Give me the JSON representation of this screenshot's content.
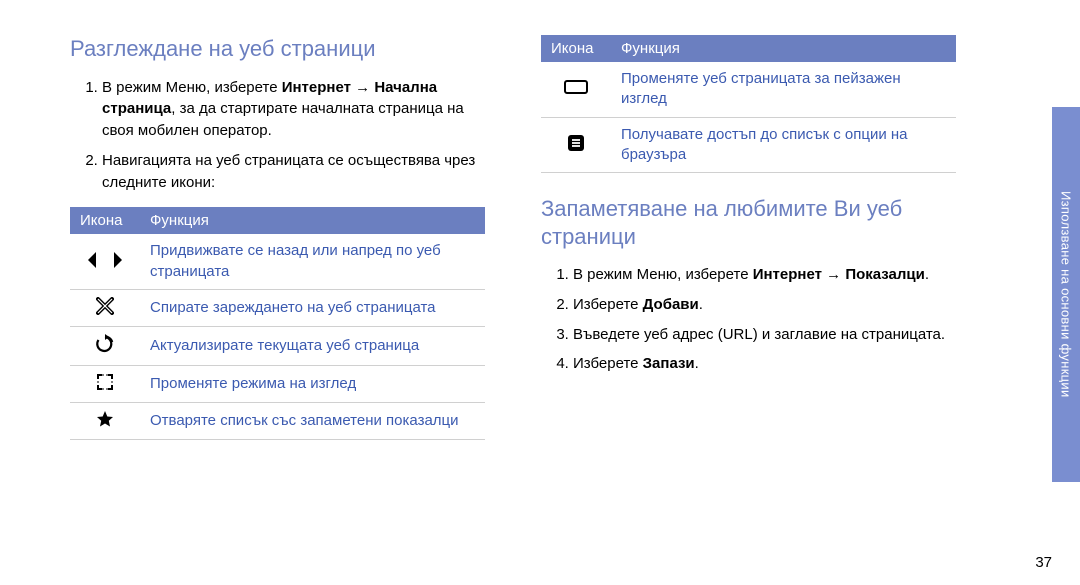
{
  "left": {
    "heading": "Разглеждане на уеб страници",
    "step1_pre": "В режим Меню, изберете ",
    "step1_b1": "Интернет",
    "step1_arrow": " → ",
    "step1_b2": "Начална страница",
    "step1_post": ", за да стартирате началната страница на своя мобилен оператор.",
    "step2": "Навигацията на уеб страницата се осъществява чрез следните икони:",
    "th_icon": "Икона",
    "th_func": "Функция",
    "rows": [
      {
        "fn": "Придвижвате се назад или напред по уеб страницата"
      },
      {
        "fn": "Спирате зареждането на уеб страницата"
      },
      {
        "fn": "Актуализирате текущата уеб страница"
      },
      {
        "fn": "Променяте режима на изглед"
      },
      {
        "fn": "Отваряте списък със запаметени показалци"
      }
    ]
  },
  "right": {
    "th_icon": "Икона",
    "th_func": "Функция",
    "rows": [
      {
        "fn": "Променяте уеб страницата за пейзажен изглед"
      },
      {
        "fn": "Получавате достъп до списък с опции на браузъра"
      }
    ],
    "heading": "Запаметяване на любимите Ви уеб страници",
    "s1_pre": "В режим Меню, изберете ",
    "s1_b1": "Интернет",
    "s1_arrow": " → ",
    "s1_b2": "Показалци",
    "s1_post": ".",
    "s2_pre": "Изберете ",
    "s2_b": "Добави",
    "s2_post": ".",
    "s3": "Въведете уеб адрес (URL) и заглавие на страницата.",
    "s4_pre": "Изберете ",
    "s4_b": "Запази",
    "s4_post": "."
  },
  "side_tab": "Използване на основни функции",
  "page_number": "37"
}
